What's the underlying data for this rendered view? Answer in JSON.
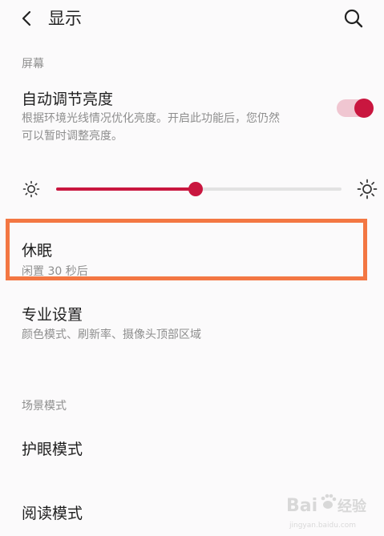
{
  "header": {
    "title": "显示"
  },
  "sections": {
    "screen": "屏幕",
    "scene_mode": "场景模式"
  },
  "auto_brightness": {
    "title": "自动调节亮度",
    "desc_line1": "根据环境光线情况优化亮度。开启此功能后，您仍然",
    "desc_line2": "可以暂时调整亮度。",
    "enabled": true
  },
  "brightness_slider": {
    "level": 0.49
  },
  "sleep": {
    "title": "休眠",
    "subtitle": "闲置 30 秒后"
  },
  "pro_settings": {
    "title": "专业设置",
    "subtitle": "颜色模式、刷新率、摄像头顶部区域"
  },
  "eye_care": {
    "title": "护眼模式"
  },
  "reading_mode": {
    "title": "阅读模式"
  },
  "watermark": {
    "brand": "Bai",
    "brand_suffix": "经验",
    "site": "jingyan.baidu.com"
  },
  "colors": {
    "accent": "#c9163f",
    "highlight_border": "#f37743"
  }
}
